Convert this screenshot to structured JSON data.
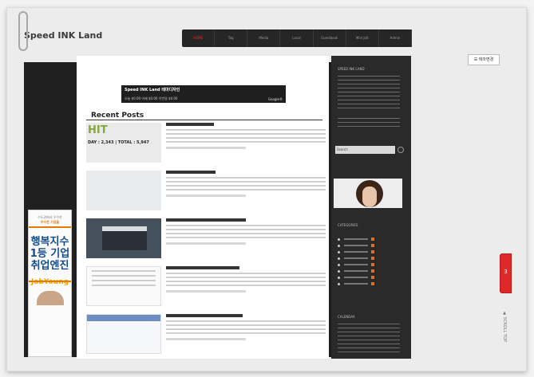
{
  "site": {
    "title": "Speed INK Land"
  },
  "nav": {
    "items": [
      "HOME",
      "Tag",
      "Media",
      "Local",
      "Guestbook",
      "Mini Jolt",
      "Admin"
    ],
    "active": "HOME"
  },
  "theme_button": "☰ 테마변경",
  "google_bar": {
    "title": "Speed INK Land 테마디자인",
    "stats": "오늘  $0.00   어제  $0.00   이번달  $0.00",
    "right": "Google®"
  },
  "recent_posts": {
    "heading": "Recent Posts"
  },
  "hit_counter": {
    "main": "HIT",
    "sub": "DAY : 2,343 | TOTAL : 5,947"
  },
  "ad": {
    "line1": "수도권에서 우수한",
    "line1_highlight": "우수한 기업을",
    "line2": "행복지수",
    "line3": "1등 기업",
    "line4": "취업엔진",
    "logo": "JobYoung"
  },
  "sidebar": {
    "about": "SPEED INK LAND",
    "search_placeholder": "Search",
    "categories": "CATEGORIES",
    "calendar": "CALENDAR"
  },
  "red_tab": "3",
  "side_vertical": "▲ SCROLL TOP",
  "colors": {
    "accent": "#e02828",
    "hit_green": "#86a73a",
    "orange": "#e07a00"
  }
}
